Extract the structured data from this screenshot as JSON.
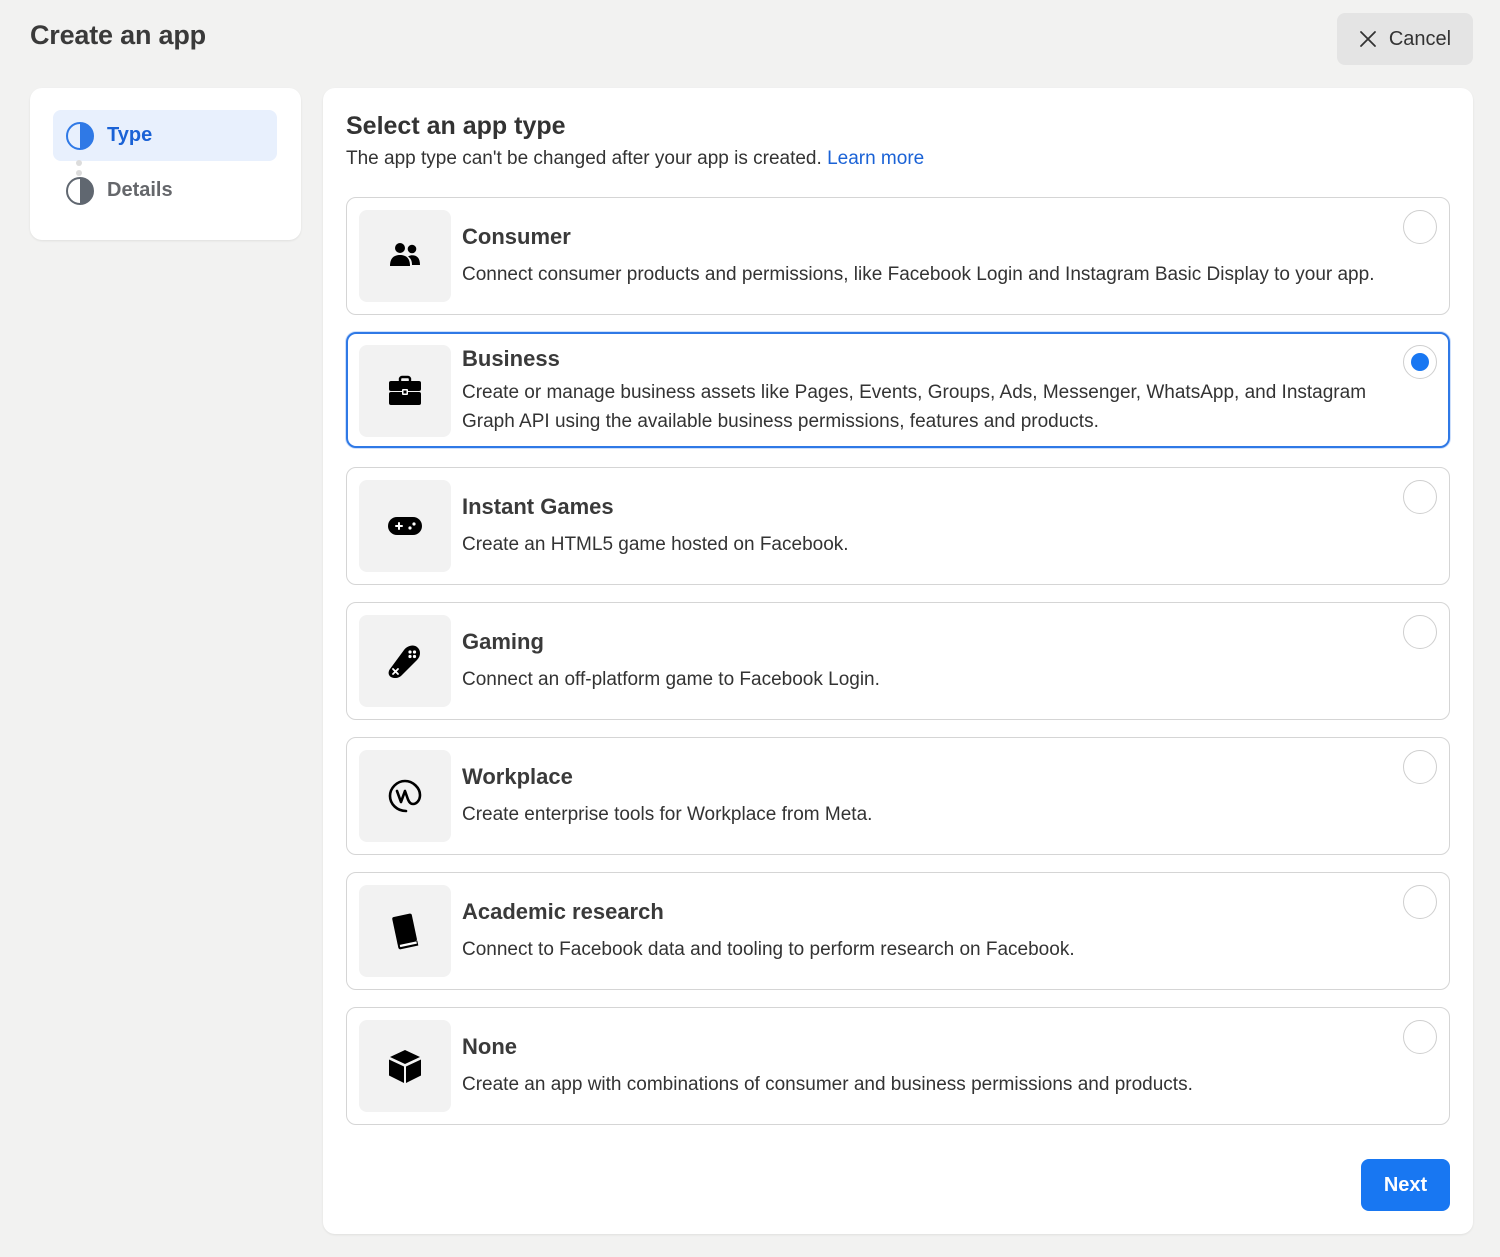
{
  "header": {
    "title": "Create an app",
    "cancel_label": "Cancel",
    "cancel_icon": "close-icon"
  },
  "steps": [
    {
      "label": "Type",
      "state": "active",
      "icon": "half-circle-icon"
    },
    {
      "label": "Details",
      "state": "inactive",
      "icon": "half-circle-icon"
    }
  ],
  "main": {
    "title": "Select an app type",
    "subtitle": "The app type can't be changed after your app is created.",
    "learn_more": "Learn more",
    "options": [
      {
        "title": "Consumer",
        "description": "Connect consumer products and permissions, like Facebook Login and Instagram Basic Display to your app.",
        "icon": "people-icon",
        "selected": false
      },
      {
        "title": "Business",
        "description": "Create or manage business assets like Pages, Events, Groups, Ads, Messenger, WhatsApp, and Instagram Graph API using the available business permissions, features and products.",
        "icon": "briefcase-icon",
        "selected": true
      },
      {
        "title": "Instant Games",
        "description": "Create an HTML5 game hosted on Facebook.",
        "icon": "gamepad-icon",
        "selected": false
      },
      {
        "title": "Gaming",
        "description": "Connect an off-platform game to Facebook Login.",
        "icon": "controller-icon",
        "selected": false
      },
      {
        "title": "Workplace",
        "description": "Create enterprise tools for Workplace from Meta.",
        "icon": "workplace-icon",
        "selected": false
      },
      {
        "title": "Academic research",
        "description": "Connect to Facebook data and tooling to perform research on Facebook.",
        "icon": "book-icon",
        "selected": false
      },
      {
        "title": "None",
        "description": "Create an app with combinations of consumer and business permissions and products.",
        "icon": "cube-icon",
        "selected": false
      }
    ],
    "next_label": "Next"
  },
  "colors": {
    "accent": "#1877f2",
    "link": "#1a62d6",
    "active_step_bg": "#e8f0fd",
    "background": "#f2f2f1"
  }
}
